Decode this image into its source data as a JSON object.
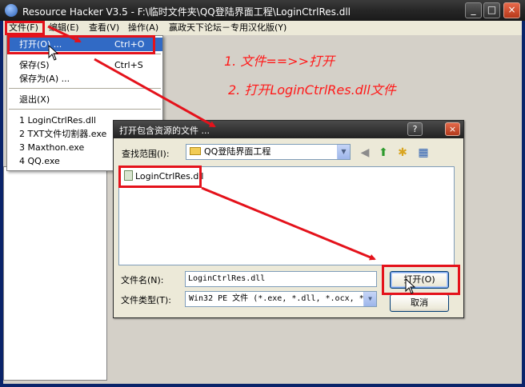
{
  "window": {
    "title": "Resource Hacker V3.5  -  F:\\临时文件夹\\QQ登陆界面工程\\LoginCtrlRes.dll",
    "min_label": "_",
    "max_label": "□",
    "close_label": "×"
  },
  "menubar": {
    "items": [
      {
        "label": "文件(F)"
      },
      {
        "label": "编辑(E)"
      },
      {
        "label": "查看(V)"
      },
      {
        "label": "操作(A)"
      },
      {
        "label": "赢政天下论坛－专用汉化版(Y)"
      }
    ]
  },
  "file_menu": {
    "open": {
      "label": "打开(O) ...",
      "shortcut": "Ctrl+O"
    },
    "save": {
      "label": "保存(S)",
      "shortcut": "Ctrl+S"
    },
    "save_as": {
      "label": "保存为(A) ..."
    },
    "exit": {
      "label": "退出(X)"
    },
    "recent": [
      {
        "label": "1 LoginCtrlRes.dll"
      },
      {
        "label": "2 TXT文件切割器.exe"
      },
      {
        "label": "3 Maxthon.exe"
      },
      {
        "label": "4 QQ.exe"
      }
    ]
  },
  "annotations": {
    "step1": "1. 文件==>>打开",
    "step2": "2. 打开LoginCtrlRes.dll文件"
  },
  "dialog": {
    "title": "打开包含资源的文件 ...",
    "help_label": "?",
    "close_label": "×",
    "lookin_label": "查找范围(I):",
    "lookin_value": "QQ登陆界面工程",
    "files": [
      {
        "name": "LoginCtrlRes.dll"
      }
    ],
    "filename_label": "文件名(N):",
    "filename_value": "LoginCtrlRes.dll",
    "filetype_label": "文件类型(T):",
    "filetype_value": "Win32 PE 文件 (*.exe, *.dll, *.ocx, *",
    "open_button": "打开(O)",
    "cancel_button": "取消"
  },
  "colors": {
    "annotation": "#e4121b",
    "highlight": "#316ac5"
  }
}
